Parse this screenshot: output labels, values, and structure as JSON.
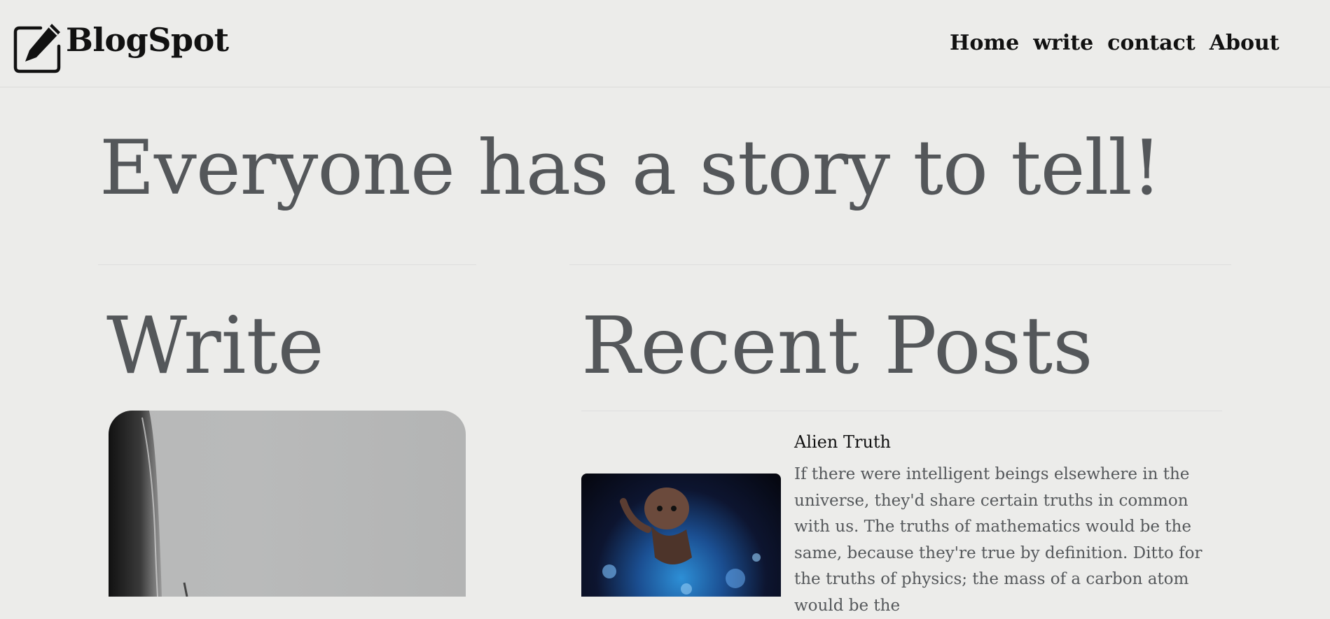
{
  "header": {
    "brand": "BlogSpot",
    "logo_icon": "edit-square-icon",
    "nav": [
      {
        "label": "Home"
      },
      {
        "label": "write"
      },
      {
        "label": "contact"
      },
      {
        "label": "About"
      }
    ]
  },
  "hero": {
    "title": "Everyone has a story to tell!"
  },
  "write_section": {
    "title": "Write"
  },
  "recent_posts": {
    "title": "Recent Posts",
    "posts": [
      {
        "title": "Alien Truth",
        "excerpt": "If there were intelligent beings elsewhere in the universe, they'd share certain truths in common with us. The truths of mathematics would be the same, because they're true by definition. Ditto for the truths of physics; the mass of a carbon atom would be the"
      }
    ]
  },
  "colors": {
    "background": "#ececea",
    "heading_gray": "#54575a",
    "text_dark": "#111111"
  }
}
